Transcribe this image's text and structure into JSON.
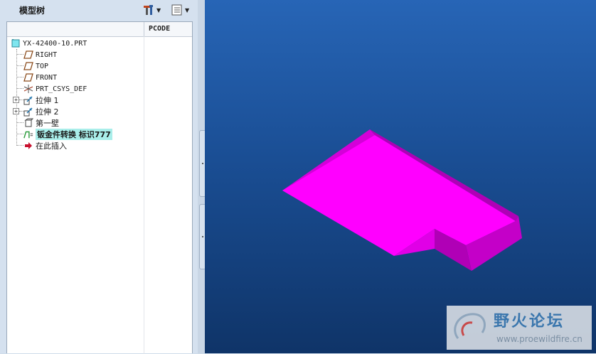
{
  "panel": {
    "title": "模型树",
    "column_header": "PCODE"
  },
  "tree": {
    "items": [
      {
        "label": "YX-42400-10.PRT",
        "icon": "part-icon"
      },
      {
        "label": "RIGHT",
        "icon": "datum-plane-icon"
      },
      {
        "label": "TOP",
        "icon": "datum-plane-icon"
      },
      {
        "label": "FRONT",
        "icon": "datum-plane-icon"
      },
      {
        "label": "PRT_CSYS_DEF",
        "icon": "coordinate-system-icon"
      },
      {
        "label": "拉伸 1",
        "icon": "extrude-icon"
      },
      {
        "label": "拉伸 2",
        "icon": "extrude-icon"
      },
      {
        "label": "第一壁",
        "icon": "wall-icon"
      },
      {
        "label": "钣金件转换 标识777",
        "icon": "sheetmetal-convert-icon"
      },
      {
        "label": "在此插入",
        "icon": "insert-here-arrow-icon"
      }
    ]
  },
  "watermark": {
    "title": "野火论坛",
    "url": "www.proewildfire.cn"
  },
  "colors": {
    "model_top": "#ff00ff",
    "model_side_dark": "#b000b6",
    "model_side_mid": "#d400d8",
    "viewport_top": "#2765b6",
    "viewport_bottom": "#0f3468",
    "highlight": "#a9eeea"
  }
}
